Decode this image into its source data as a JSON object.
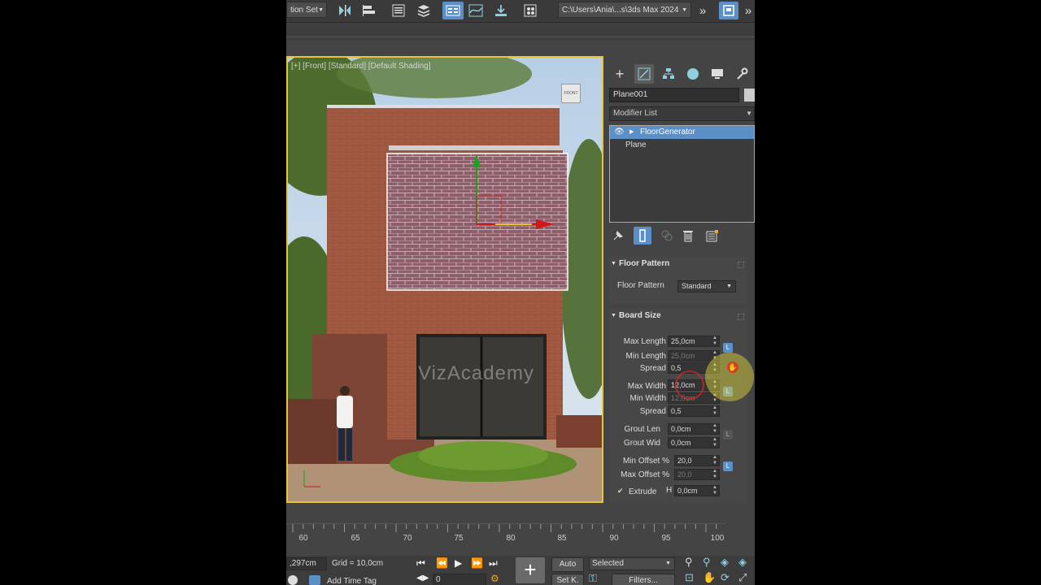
{
  "toolbar": {
    "selection_set_label": "tion Set",
    "project_path": "C:\\Users\\Ania\\...s\\3ds Max 2024"
  },
  "viewport": {
    "label": "[+] [Front] [Standard] [Default Shading]",
    "navcube_label": "FRONT",
    "watermark": "VizAcademy"
  },
  "command_panel": {
    "object_name": "Plane001",
    "modifier_list": "Modifier List",
    "stack": [
      {
        "label": "FloorGenerator",
        "selected": true
      },
      {
        "label": "Plane",
        "selected": false
      }
    ],
    "floor_pattern": {
      "title": "Floor Pattern",
      "label": "Floor Pattern",
      "value": "Standard"
    },
    "board_size": {
      "title": "Board Size",
      "max_length_label": "Max Length",
      "max_length": "25,0cm",
      "min_length_label": "Min Length",
      "min_length": "25,0cm",
      "spread1_label": "Spread",
      "spread1": "0,5",
      "max_width_label": "Max Width",
      "max_width": "12,0cm",
      "min_width_label": "Min Width",
      "min_width": "12,0cm",
      "spread2_label": "Spread",
      "spread2": "0,5",
      "grout_len_label": "Grout Len",
      "grout_len": "0,0cm",
      "grout_wid_label": "Grout Wid",
      "grout_wid": "0,0cm",
      "min_offset_label": "Min Offset %",
      "min_offset": "20,0",
      "max_offset_label": "Max Offset %",
      "max_offset": "20,0",
      "extrude_label": "Extrude",
      "extrude_h_label": "H",
      "extrude_h": "0,0cm",
      "lock_label": "L"
    }
  },
  "timeline": {
    "ticks": [
      "60",
      "65",
      "70",
      "75",
      "80",
      "85",
      "90",
      "95",
      "100"
    ]
  },
  "statusbar": {
    "coord_value": ",297cm",
    "grid_label": "Grid = 10,0cm",
    "add_time_tag": "Add Time Tag",
    "frame_value": "0",
    "auto_label": "Auto",
    "setkey_label": "Set K.",
    "selected_value": "Selected",
    "filters_label": "Filters..."
  },
  "colors": {
    "accent_blue": "#5b8fc7",
    "viewport_border": "#e6c53a",
    "brick": "#a35a43",
    "selected_wall": "#8e5f6a"
  }
}
